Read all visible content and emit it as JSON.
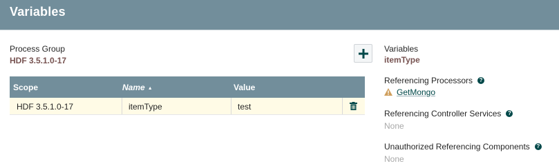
{
  "header": {
    "title": "Variables"
  },
  "process_group": {
    "label": "Process Group",
    "name": "HDF 3.5.1.0-17"
  },
  "table": {
    "columns": [
      {
        "label": "Scope"
      },
      {
        "label": "Name",
        "sort_indicator": "▲"
      },
      {
        "label": "Value"
      }
    ],
    "rows": [
      {
        "scope": "HDF 3.5.1.0-17",
        "name": "itemType",
        "value": "test"
      }
    ]
  },
  "details": {
    "variables_label": "Variables",
    "variables_value": "itemType",
    "ref_processors_label": "Referencing Processors",
    "ref_processors": [
      {
        "name": "GetMongo",
        "icon": "warning-icon"
      }
    ],
    "ref_controller_services_label": "Referencing Controller Services",
    "ref_controller_services_value": "None",
    "unauthorized_label": "Unauthorized Referencing Components",
    "unauthorized_value": "None",
    "help_glyph": "?"
  },
  "colors": {
    "header_bg": "#728e9b",
    "accent_value": "#775351",
    "link": "#004849",
    "row_highlight": "#fffbe6",
    "warning": "#cf9f5d"
  }
}
